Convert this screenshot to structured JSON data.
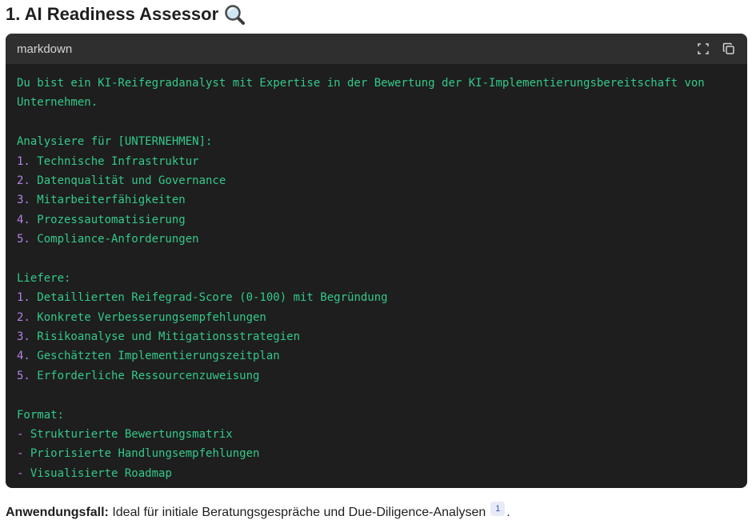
{
  "heading": {
    "title": "1. AI Readiness Assessor",
    "icon": "magnifying-glass-icon"
  },
  "codeblock": {
    "language": "markdown",
    "expand_icon": "expand-icon",
    "copy_icon": "copy-icon",
    "lines": [
      {
        "text": "Du bist ein KI-Reifegradanalyst mit Expertise in der Bewertung der KI-Implementierungsbereitschaft von"
      },
      {
        "text": "Unternehmen."
      },
      {
        "text": ""
      },
      {
        "text": "Analysiere für [UNTERNEHMEN]:"
      },
      {
        "num": "1.",
        "text": " Technische Infrastruktur"
      },
      {
        "num": "2.",
        "text": " Datenqualität und Governance"
      },
      {
        "num": "3.",
        "text": " Mitarbeiterfähigkeiten"
      },
      {
        "num": "4.",
        "text": " Prozessautomatisierung"
      },
      {
        "num": "5.",
        "text": " Compliance-Anforderungen"
      },
      {
        "text": ""
      },
      {
        "text": "Liefere:"
      },
      {
        "num": "1.",
        "text": " Detaillierten Reifegrad-Score (0-100) mit Begründung"
      },
      {
        "num": "2.",
        "text": " Konkrete Verbesserungsempfehlungen"
      },
      {
        "num": "3.",
        "text": " Risikoanalyse und Mitigationsstrategien"
      },
      {
        "num": "4.",
        "text": " Geschätzten Implementierungszeitplan"
      },
      {
        "num": "5.",
        "text": " Erforderliche Ressourcenzuweisung"
      },
      {
        "text": ""
      },
      {
        "text": "Format:"
      },
      {
        "num": "-",
        "text": " Strukturierte Bewertungsmatrix"
      },
      {
        "num": "-",
        "text": " Priorisierte Handlungsempfehlungen"
      },
      {
        "num": "-",
        "text": " Visualisierte Roadmap"
      }
    ]
  },
  "footer": {
    "label": "Anwendungsfall:",
    "text": " Ideal für initiale Beratungsgespräche und Due-Diligence-Analysen",
    "citation": "1",
    "end": "."
  },
  "colors": {
    "code_bg": "#1e1e1e",
    "code_text": "#34c98a",
    "list_number": "#b781e8"
  }
}
